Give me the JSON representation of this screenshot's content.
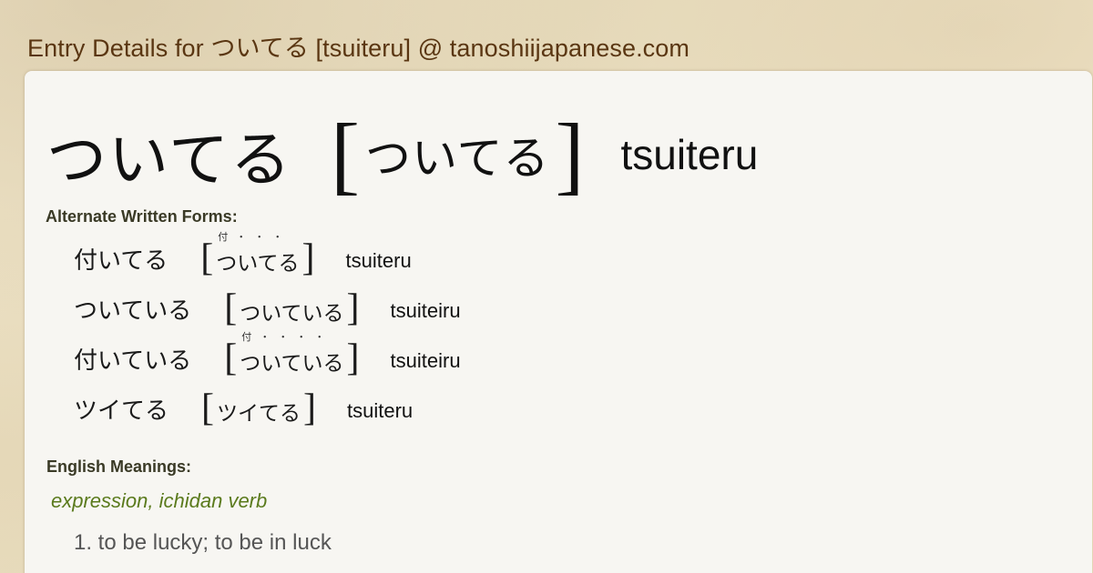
{
  "page_title": "Entry Details for ついてる [tsuiteru] @ tanoshiijapanese.com",
  "entry": {
    "word": "ついてる",
    "reading": "ついてる",
    "romaji": "tsuiteru"
  },
  "alternate_forms": {
    "heading": "Alternate Written Forms:",
    "items": [
      {
        "written": "付いてる",
        "furigana": "付・・・",
        "reading": "ついてる",
        "romaji": "tsuiteru"
      },
      {
        "written": "ついている",
        "furigana": "",
        "reading": "ついている",
        "romaji": "tsuiteiru"
      },
      {
        "written": "付いている",
        "furigana": "付・・・・",
        "reading": "ついている",
        "romaji": "tsuiteiru"
      },
      {
        "written": "ツイてる",
        "furigana": "",
        "reading": "ツイてる",
        "romaji": "tsuiteru"
      }
    ]
  },
  "meanings": {
    "heading": "English Meanings:",
    "part_of_speech": "expression, ichidan verb",
    "items": [
      "1. to be lucky; to be in luck"
    ]
  },
  "colors": {
    "title": "#5a3612",
    "pos": "#5a7a1c",
    "card": "#f7f6f2"
  }
}
